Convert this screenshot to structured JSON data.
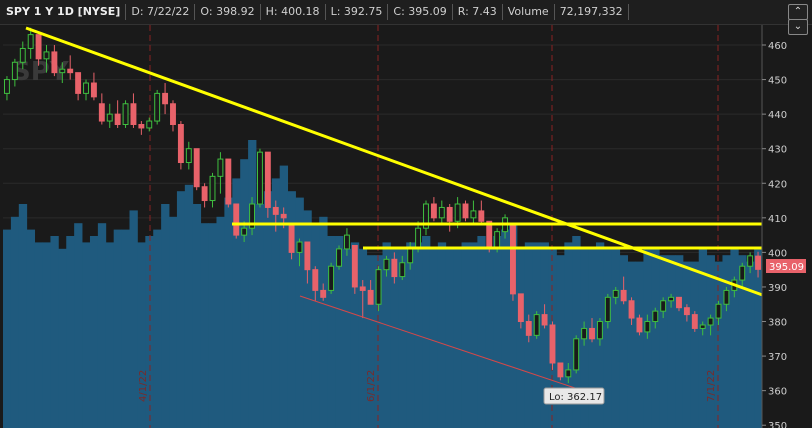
{
  "header": {
    "symbol": "SPY 1 Y 1D [NYSE]",
    "date": "D: 7/22/22",
    "open": "O: 398.92",
    "high": "H: 400.18",
    "low": "L: 392.75",
    "close": "C: 395.09",
    "range": "R: 7.43",
    "volume_label": "Volume",
    "volume_value": "72,197,332"
  },
  "watermark": "SPY",
  "colors": {
    "up": "#3fbf3f",
    "down": "#e8626a",
    "volume": "#1f5a7e",
    "trendline": "#ffff00",
    "price_badge": "#e8626a",
    "background": "#1a1a1a"
  },
  "chart_data": {
    "type": "candlestick",
    "price_axis": {
      "min": 350,
      "max": 465,
      "ticks": [
        350,
        360,
        370,
        380,
        390,
        400,
        410,
        420,
        430,
        440,
        450,
        460
      ]
    },
    "last_price_label": "395.09",
    "low_label": "Lo: 362.17",
    "month_marker_labels": [
      "4/1/22",
      "6/1/22",
      "7/1/22"
    ],
    "candles": [
      {
        "o": 446,
        "h": 451,
        "l": 444,
        "c": 450
      },
      {
        "o": 450,
        "h": 456,
        "l": 448,
        "c": 455
      },
      {
        "o": 455,
        "h": 461,
        "l": 453,
        "c": 459
      },
      {
        "o": 459,
        "h": 465,
        "l": 456,
        "c": 463
      },
      {
        "o": 463,
        "h": 463,
        "l": 454,
        "c": 456
      },
      {
        "o": 456,
        "h": 460,
        "l": 452,
        "c": 458
      },
      {
        "o": 458,
        "h": 460,
        "l": 451,
        "c": 452
      },
      {
        "o": 452,
        "h": 455,
        "l": 449,
        "c": 453
      },
      {
        "o": 453,
        "h": 457,
        "l": 450,
        "c": 452
      },
      {
        "o": 452,
        "h": 452,
        "l": 444,
        "c": 446
      },
      {
        "o": 446,
        "h": 450,
        "l": 444,
        "c": 449
      },
      {
        "o": 449,
        "h": 452,
        "l": 444,
        "c": 445
      },
      {
        "o": 443,
        "h": 446,
        "l": 437,
        "c": 438
      },
      {
        "o": 438,
        "h": 443,
        "l": 436,
        "c": 440
      },
      {
        "o": 440,
        "h": 444,
        "l": 436,
        "c": 437
      },
      {
        "o": 437,
        "h": 444,
        "l": 436,
        "c": 443
      },
      {
        "o": 443,
        "h": 446,
        "l": 436,
        "c": 437
      },
      {
        "o": 437,
        "h": 438,
        "l": 434,
        "c": 436
      },
      {
        "o": 436,
        "h": 439,
        "l": 435,
        "c": 438
      },
      {
        "o": 438,
        "h": 447,
        "l": 437,
        "c": 446
      },
      {
        "o": 446,
        "h": 449,
        "l": 440,
        "c": 443
      },
      {
        "o": 443,
        "h": 444,
        "l": 435,
        "c": 437
      },
      {
        "o": 437,
        "h": 438,
        "l": 424,
        "c": 426
      },
      {
        "o": 426,
        "h": 432,
        "l": 424,
        "c": 430
      },
      {
        "o": 430,
        "h": 430,
        "l": 418,
        "c": 419
      },
      {
        "o": 419,
        "h": 420,
        "l": 413,
        "c": 415
      },
      {
        "o": 415,
        "h": 423,
        "l": 413,
        "c": 422
      },
      {
        "o": 422,
        "h": 429,
        "l": 417,
        "c": 427
      },
      {
        "o": 427,
        "h": 427,
        "l": 413,
        "c": 414
      },
      {
        "o": 414,
        "h": 414,
        "l": 404,
        "c": 405
      },
      {
        "o": 405,
        "h": 409,
        "l": 403,
        "c": 407
      },
      {
        "o": 407,
        "h": 416,
        "l": 405,
        "c": 414
      },
      {
        "o": 414,
        "h": 430,
        "l": 413,
        "c": 429
      },
      {
        "o": 429,
        "h": 429,
        "l": 410,
        "c": 413
      },
      {
        "o": 413,
        "h": 415,
        "l": 406,
        "c": 411
      },
      {
        "o": 411,
        "h": 413,
        "l": 407,
        "c": 410
      },
      {
        "o": 408,
        "h": 408,
        "l": 398,
        "c": 400
      },
      {
        "o": 400,
        "h": 404,
        "l": 396,
        "c": 403
      },
      {
        "o": 403,
        "h": 403,
        "l": 391,
        "c": 395
      },
      {
        "o": 395,
        "h": 396,
        "l": 386,
        "c": 389
      },
      {
        "o": 389,
        "h": 391,
        "l": 386,
        "c": 387
      },
      {
        "o": 389,
        "h": 397,
        "l": 388,
        "c": 396
      },
      {
        "o": 396,
        "h": 402,
        "l": 395,
        "c": 401
      },
      {
        "o": 401,
        "h": 407,
        "l": 399,
        "c": 405
      },
      {
        "o": 402,
        "h": 402,
        "l": 388,
        "c": 390
      },
      {
        "o": 390,
        "h": 392,
        "l": 381,
        "c": 389
      },
      {
        "o": 389,
        "h": 392,
        "l": 385,
        "c": 385
      },
      {
        "o": 385,
        "h": 396,
        "l": 383,
        "c": 395
      },
      {
        "o": 395,
        "h": 399,
        "l": 393,
        "c": 398
      },
      {
        "o": 398,
        "h": 400,
        "l": 391,
        "c": 393
      },
      {
        "o": 393,
        "h": 399,
        "l": 392,
        "c": 397
      },
      {
        "o": 397,
        "h": 403,
        "l": 395,
        "c": 401
      },
      {
        "o": 401,
        "h": 409,
        "l": 400,
        "c": 407
      },
      {
        "o": 407,
        "h": 415,
        "l": 405,
        "c": 414
      },
      {
        "o": 414,
        "h": 416,
        "l": 409,
        "c": 410
      },
      {
        "o": 410,
        "h": 415,
        "l": 408,
        "c": 413
      },
      {
        "o": 413,
        "h": 414,
        "l": 406,
        "c": 409
      },
      {
        "o": 409,
        "h": 416,
        "l": 407,
        "c": 414
      },
      {
        "o": 414,
        "h": 415,
        "l": 409,
        "c": 410
      },
      {
        "o": 410,
        "h": 415,
        "l": 408,
        "c": 412
      },
      {
        "o": 412,
        "h": 415,
        "l": 408,
        "c": 409
      },
      {
        "o": 409,
        "h": 409,
        "l": 400,
        "c": 401
      },
      {
        "o": 401,
        "h": 407,
        "l": 400,
        "c": 406
      },
      {
        "o": 406,
        "h": 411,
        "l": 404,
        "c": 410
      },
      {
        "o": 408,
        "h": 408,
        "l": 386,
        "c": 388
      },
      {
        "o": 388,
        "h": 388,
        "l": 378,
        "c": 380
      },
      {
        "o": 380,
        "h": 382,
        "l": 374,
        "c": 376
      },
      {
        "o": 376,
        "h": 383,
        "l": 375,
        "c": 382
      },
      {
        "o": 382,
        "h": 385,
        "l": 378,
        "c": 379
      },
      {
        "o": 379,
        "h": 380,
        "l": 366,
        "c": 368
      },
      {
        "o": 368,
        "h": 368,
        "l": 363,
        "c": 364
      },
      {
        "o": 364,
        "h": 368,
        "l": 362.17,
        "c": 366
      },
      {
        "o": 366,
        "h": 376,
        "l": 365,
        "c": 375
      },
      {
        "o": 375,
        "h": 380,
        "l": 373,
        "c": 378
      },
      {
        "o": 378,
        "h": 381,
        "l": 374,
        "c": 375
      },
      {
        "o": 375,
        "h": 381,
        "l": 373,
        "c": 380
      },
      {
        "o": 380,
        "h": 388,
        "l": 378,
        "c": 387
      },
      {
        "o": 387,
        "h": 390,
        "l": 385,
        "c": 389
      },
      {
        "o": 389,
        "h": 393,
        "l": 385,
        "c": 386
      },
      {
        "o": 386,
        "h": 387,
        "l": 379,
        "c": 381
      },
      {
        "o": 381,
        "h": 382,
        "l": 376,
        "c": 377
      },
      {
        "o": 377,
        "h": 382,
        "l": 375,
        "c": 380
      },
      {
        "o": 380,
        "h": 384,
        "l": 378,
        "c": 383
      },
      {
        "o": 383,
        "h": 387,
        "l": 381,
        "c": 386
      },
      {
        "o": 386,
        "h": 388,
        "l": 384,
        "c": 387
      },
      {
        "o": 387,
        "h": 387,
        "l": 383,
        "c": 384
      },
      {
        "o": 384,
        "h": 385,
        "l": 380,
        "c": 382
      },
      {
        "o": 382,
        "h": 383,
        "l": 377,
        "c": 378
      },
      {
        "o": 378,
        "h": 380,
        "l": 376,
        "c": 379
      },
      {
        "o": 379,
        "h": 382,
        "l": 376,
        "c": 381
      },
      {
        "o": 381,
        "h": 386,
        "l": 379,
        "c": 385
      },
      {
        "o": 385,
        "h": 390,
        "l": 383,
        "c": 389
      },
      {
        "o": 389,
        "h": 393,
        "l": 387,
        "c": 392
      },
      {
        "o": 392,
        "h": 397,
        "l": 390,
        "c": 396
      },
      {
        "o": 396,
        "h": 400,
        "l": 394,
        "c": 399
      },
      {
        "o": 398.92,
        "h": 400.18,
        "l": 392.75,
        "c": 395.09
      }
    ],
    "volume": [
      62,
      66,
      70,
      62,
      58,
      58,
      60,
      56,
      60,
      64,
      58,
      60,
      64,
      58,
      62,
      62,
      68,
      58,
      60,
      62,
      70,
      66,
      74,
      76,
      70,
      64,
      64,
      66,
      72,
      78,
      84,
      90,
      70,
      74,
      78,
      82,
      74,
      72,
      68,
      64,
      66,
      60,
      60,
      56,
      58,
      56,
      54,
      54,
      58,
      56,
      56,
      58,
      58,
      60,
      56,
      58,
      56,
      56,
      58,
      58,
      60,
      56,
      60,
      62,
      64,
      56,
      58,
      58,
      58,
      56,
      54,
      58,
      60,
      56,
      56,
      58,
      56,
      56,
      54,
      52,
      52,
      56,
      56,
      54,
      54,
      54,
      52,
      52,
      56,
      54,
      52,
      54,
      56,
      54,
      52,
      56,
      54,
      54
    ]
  }
}
